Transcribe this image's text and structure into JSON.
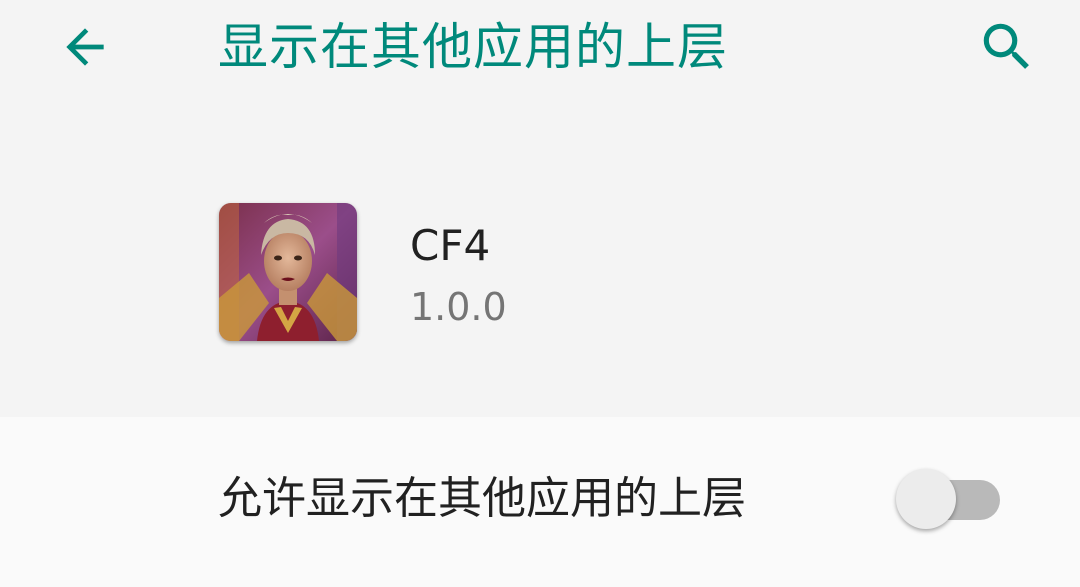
{
  "toolbar": {
    "title": "显示在其他应用的上层",
    "back_icon": "arrow-back-icon",
    "search_icon": "search-icon"
  },
  "app": {
    "name": "CF4",
    "version": "1.0.0",
    "icon": "app-icon"
  },
  "setting": {
    "label": "允许显示在其他应用的上层",
    "enabled": false
  },
  "colors": {
    "accent": "#00897b",
    "background": "#f4f4f4",
    "row_background": "#fafafa",
    "switch_track_off": "#b9b9b9",
    "switch_thumb_off": "#ececec"
  }
}
